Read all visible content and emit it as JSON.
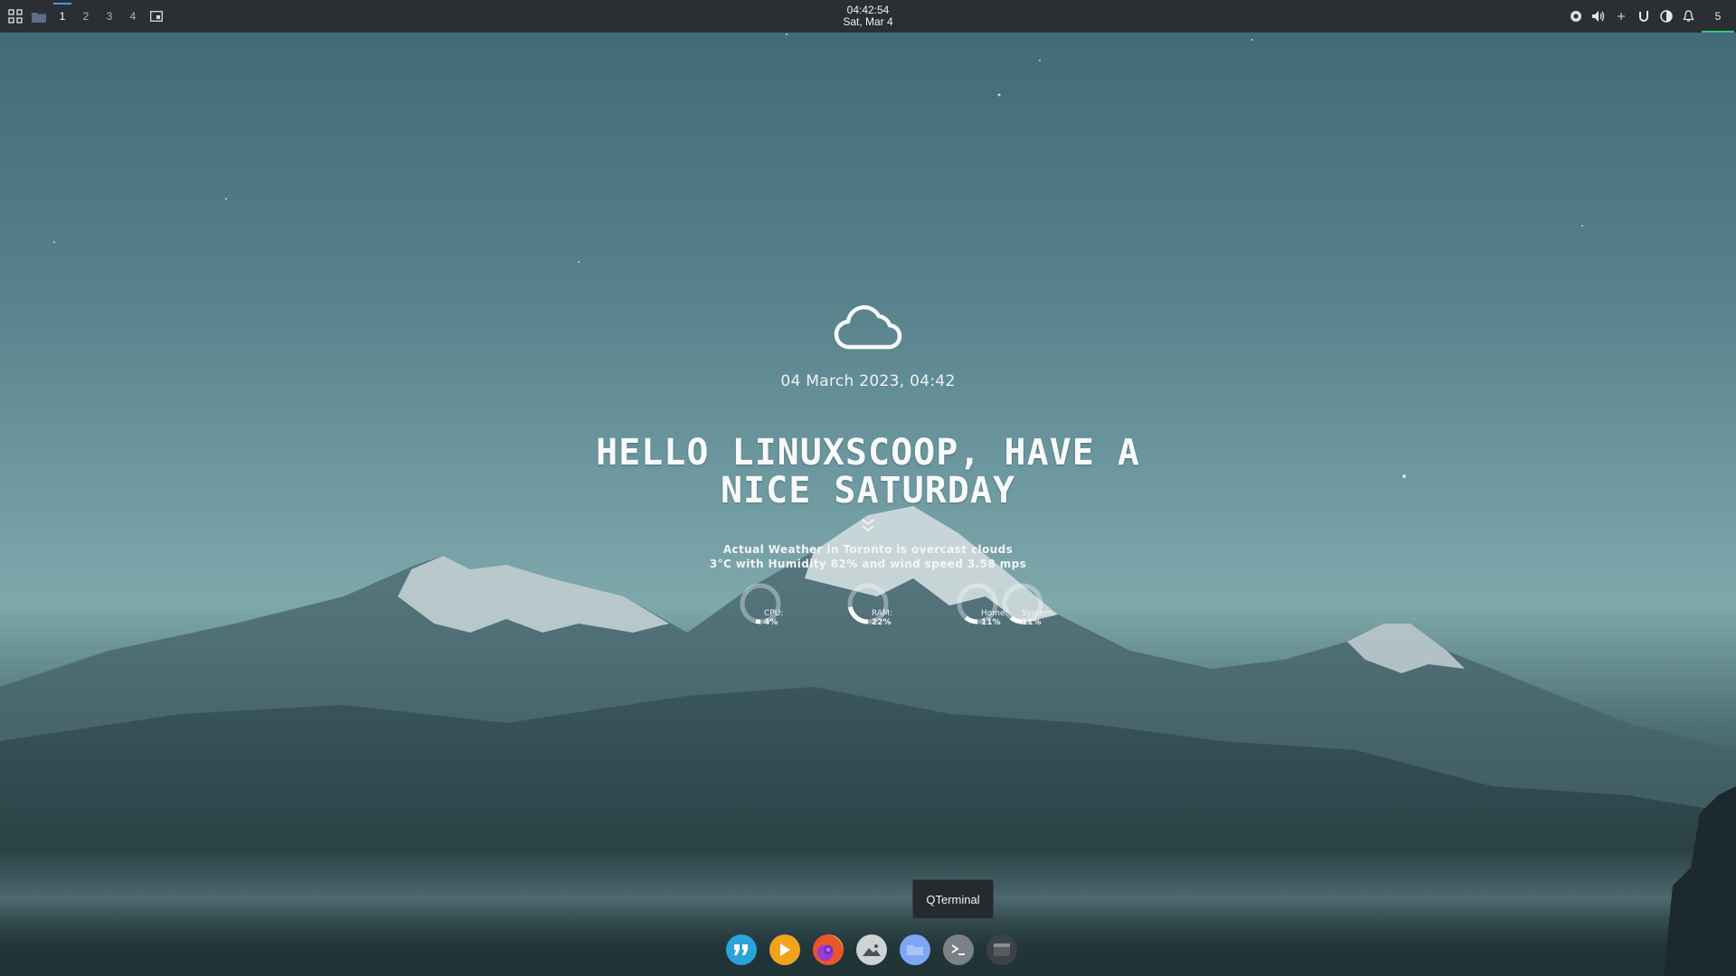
{
  "topbar": {
    "workspaces": [
      "1",
      "2",
      "3",
      "4"
    ],
    "active_workspace": "1",
    "clock_time": "04:42:54",
    "clock_date": "Sat, Mar 4",
    "tray_icons": [
      "network-icon",
      "volume-icon",
      "plus-icon",
      "update-icon",
      "settings-icon",
      "bell-icon"
    ],
    "notification_count": "5"
  },
  "widget": {
    "weather_icon": "cloud-icon",
    "datetime": "04 March 2023, 04:42",
    "greeting_line1": "HELLO LINUXSCOOP, HAVE A",
    "greeting_line2": "NICE SATURDAY",
    "weather_line1": "Actual Weather in Toronto is overcast clouds",
    "weather_line2": "3°C with Humidity 82% and wind speed 3.58 mps",
    "gauges": [
      {
        "label": "CPU:",
        "value": "4%",
        "fraction": 0.04
      },
      {
        "label": "RAM:",
        "value": "22%",
        "fraction": 0.22
      },
      {
        "label": "Home:",
        "value": "11%",
        "fraction": 0.11
      },
      {
        "label": "System:",
        "value": "11%",
        "fraction": 0.11
      }
    ]
  },
  "dock": {
    "tooltip": "QTerminal",
    "apps": [
      "quote-app",
      "media-player",
      "firefox",
      "image-viewer",
      "file-manager",
      "qterminal",
      "app-drawer"
    ],
    "colors": {
      "quote": "#2aa3d8",
      "media": "#f0a41c",
      "firefox": "#e8562a",
      "viewer": "#d8d8d8",
      "files": "#7da7f5",
      "terminal": "#7a8287",
      "drawer": "#3d4246"
    }
  }
}
